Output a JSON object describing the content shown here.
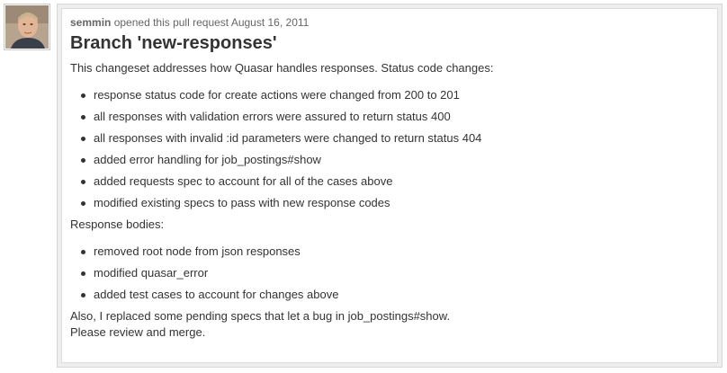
{
  "author": {
    "username": "semmin",
    "action": "opened this pull request",
    "date": "August 16, 2011"
  },
  "pull_request": {
    "title": "Branch 'new-responses'",
    "intro": "This changeset addresses how Quasar handles responses. Status code changes:",
    "status_changes": [
      "response status code for create actions were changed from 200 to 201",
      "all responses with validation errors were assured to return status 400",
      "all responses with invalid :id parameters were changed to return status 404",
      "added error handling for job_postings#show",
      "added requests spec to account for all of the cases above",
      "modified existing specs to pass with new response codes"
    ],
    "bodies_heading": "Response bodies:",
    "body_changes": [
      "removed root node from json responses",
      "modified quasar_error",
      "added test cases to account for changes above"
    ],
    "closing_line_1": "Also, I replaced some pending specs that let a bug in job_postings#show.",
    "closing_line_2": "Please review and merge."
  },
  "colors": {
    "panel_border": "#d6d6d6",
    "panel_bg": "#eeeeee",
    "text": "#333333",
    "meta_text": "#666666"
  }
}
